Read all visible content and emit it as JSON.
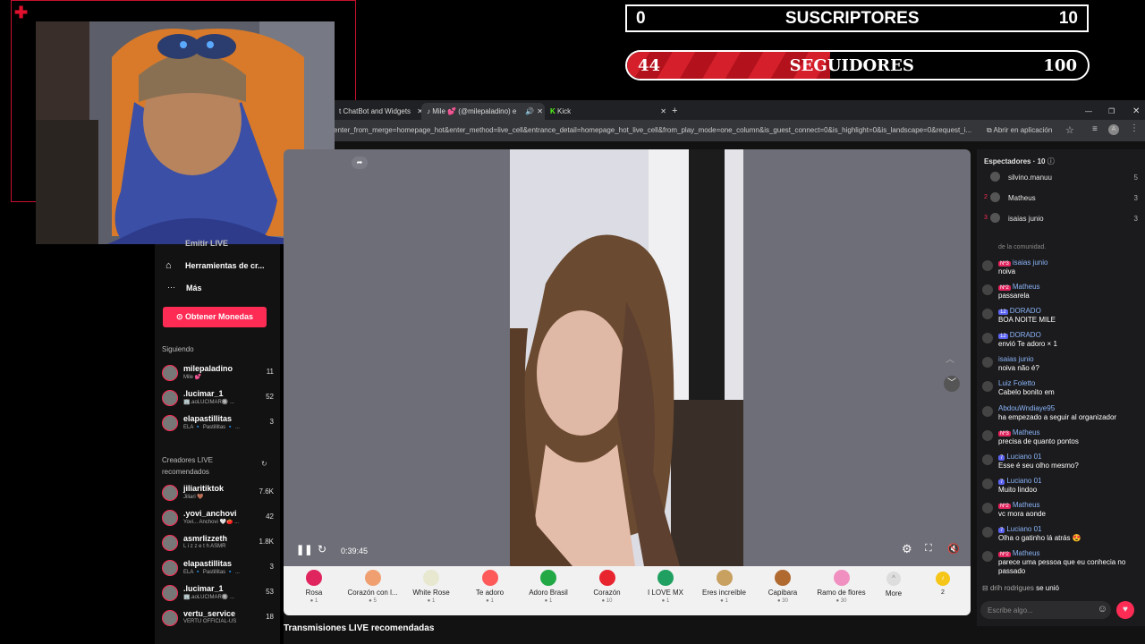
{
  "overlay": {
    "subs": {
      "current": "0",
      "label": "SUSCRIPTORES",
      "goal": "10"
    },
    "followers": {
      "current": "44",
      "label": "SEGUIDORES",
      "goal": "100",
      "progress": 0.44
    },
    "brand_color": "#c8102e"
  },
  "browser": {
    "tabs": [
      {
        "label": "t ChatBot and Widgets",
        "icon": "close-icon"
      },
      {
        "label": "Mile 💕 (@milepaladino) e",
        "icon": "close-icon"
      },
      {
        "label": "Kick",
        "icon": "close-icon"
      }
    ],
    "new_tab": "+",
    "url": "enter_from_merge=homepage_hot&enter_method=live_cell&entrance_detail=homepage_hot_live_cell&from_play_mode=one_column&is_guest_connect=0&is_highlight=0&is_landscape=0&request_i...",
    "open_in_app": "Abrir en aplicación"
  },
  "sidebar": {
    "partial_top": "Emitir LIVE",
    "tools": "Herramientas de cr...",
    "more": "Más",
    "coins_button": "Obtener Monedas",
    "following_title": "Siguiendo",
    "following": [
      {
        "name": "milepaladino",
        "sub": "Mile 💕",
        "count": "11"
      },
      {
        "name": ".lucimar_1",
        "sub": "🏢.aoLUCIMAR🔘 ...",
        "count": "52"
      },
      {
        "name": "elapastillitas",
        "sub": "ELA 🔹 Pastillitas 🔹 ...",
        "count": "3"
      }
    ],
    "recommended_title": "Creadores LIVE recomendados",
    "recommended": [
      {
        "name": "jiliaritiktok",
        "sub": "Jiliari 🤎",
        "count": "7.6K"
      },
      {
        "name": ".yovi_anchovi",
        "sub": "Yovi... Anchovi 🤍🍅 ...",
        "count": "42"
      },
      {
        "name": "asmrlizzeth",
        "sub": "L i z z e t h ASMR",
        "count": "1.8K"
      },
      {
        "name": "elapastillitas",
        "sub": "ELA 🔹 Pastillitas 🔹 ...",
        "count": "3"
      },
      {
        "name": ".lucimar_1",
        "sub": "🏢.aoLUCIMAR🔘 ...",
        "count": "53"
      },
      {
        "name": "vertu_service",
        "sub": "VERTU OFFICIAL-US",
        "count": "18"
      }
    ]
  },
  "player": {
    "time": "0:39:45",
    "recommended_footer": "Transmisiones LIVE recomendadas"
  },
  "gifts": [
    {
      "name": "Rosa",
      "cost": "1",
      "color": "#e0245e"
    },
    {
      "name": "Corazón con l...",
      "cost": "5",
      "color": "#f0a070"
    },
    {
      "name": "White Rose",
      "cost": "1",
      "color": "#e8e8d0"
    },
    {
      "name": "Te adoro",
      "cost": "1",
      "color": "#ff5a5a"
    },
    {
      "name": "Adoro Brasil",
      "cost": "1",
      "color": "#22a845"
    },
    {
      "name": "Corazón",
      "cost": "10",
      "color": "#e8242f"
    },
    {
      "name": "I LOVE MX",
      "cost": "1",
      "color": "#20a060"
    },
    {
      "name": "Eres increíble",
      "cost": "1",
      "color": "#c8a060"
    },
    {
      "name": "Capibara",
      "cost": "30",
      "color": "#b06a30"
    },
    {
      "name": "Ramo de flores",
      "cost": "30",
      "color": "#f090c0"
    }
  ],
  "gift_more": "More",
  "coin_count": "2",
  "chat": {
    "viewers_label": "Espectadores",
    "viewers_count": "10",
    "top_viewers": [
      {
        "rank": "",
        "name": "silvino.manuu",
        "score": "5"
      },
      {
        "rank": "2",
        "name": "Matheus",
        "score": "3"
      },
      {
        "rank": "3",
        "name": "isaias junio",
        "score": "3"
      }
    ],
    "notice": "de la comunidad.",
    "messages": [
      {
        "user": "isaias junio",
        "badge": "Nº3",
        "text": "noiva"
      },
      {
        "user": "Matheus",
        "badge": "Nº2",
        "text": "passarela"
      },
      {
        "user": "DORADO",
        "badge": "12",
        "text": "BOA NOITE MILE"
      },
      {
        "user": "DORADO",
        "badge": "12",
        "text": "envió Te adoro × 1"
      },
      {
        "user": "isaias junio",
        "badge": "",
        "text": "noiva não é?"
      },
      {
        "user": "Luiz Foletto",
        "badge": "",
        "text": "Cabelo bonito em"
      },
      {
        "user": "AbdouWndiaye95",
        "badge": "",
        "text": "ha empezado a seguir al organizador"
      },
      {
        "user": "Matheus",
        "badge": "Nº3",
        "text": "precisa de quanto pontos"
      },
      {
        "user": "Luciano 01",
        "badge": "7",
        "text": "Esse é seu olho mesmo?"
      },
      {
        "user": "Luciano 01",
        "badge": "7",
        "text": "Muito lindoo"
      },
      {
        "user": "Matheus",
        "badge": "Nº2",
        "text": "vc mora aonde"
      },
      {
        "user": "Luciano 01",
        "badge": "7",
        "text": "Olha o gatinho lá atrás 😍"
      },
      {
        "user": "Matheus",
        "badge": "Nº2",
        "text": "parece uma pessoa que eu conhecia no passado"
      }
    ],
    "join": {
      "user": "drih rodrigues",
      "text": "se unió"
    },
    "input_placeholder": "Escribe algo..."
  }
}
